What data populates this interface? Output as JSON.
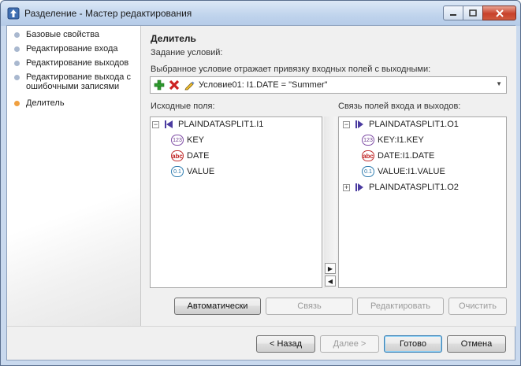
{
  "window": {
    "title": "Разделение - Мастер редактирования"
  },
  "steps": [
    {
      "label": "Базовые свойства",
      "active": false
    },
    {
      "label": "Редактирование входа",
      "active": false
    },
    {
      "label": "Редактирование выходов",
      "active": false
    },
    {
      "label": "Редактирование выхода с ошибочными записями",
      "active": false
    },
    {
      "label": "Делитель",
      "active": true
    }
  ],
  "page": {
    "title": "Делитель",
    "conditions_label": "Задание условий:",
    "selected_condition_label": "Выбранное условие отражает привязку входных полей с выходными:",
    "condition_value": "Условие01: I1.DATE = \"Summer\"",
    "source_fields_label": "Исходные поля:",
    "mapping_label": "Связь полей входа и выходов:"
  },
  "source_tree": {
    "root": "PLAINDATASPLIT1.I1",
    "fields": [
      {
        "type": "123",
        "name": "KEY"
      },
      {
        "type": "abc",
        "name": "DATE"
      },
      {
        "type": "0.1",
        "name": "VALUE"
      }
    ]
  },
  "mapping_tree": {
    "outputs": [
      {
        "name": "PLAINDATASPLIT1.O1",
        "expanded": true,
        "fields": [
          {
            "type": "123",
            "name": "KEY:I1.KEY"
          },
          {
            "type": "abc",
            "name": "DATE:I1.DATE"
          },
          {
            "type": "0.1",
            "name": "VALUE:I1.VALUE"
          }
        ]
      },
      {
        "name": "PLAINDATASPLIT1.O2",
        "expanded": false,
        "fields": []
      }
    ]
  },
  "action_buttons": {
    "auto": "Автоматически",
    "link": "Связь",
    "edit": "Редактировать",
    "clear": "Очистить"
  },
  "nav_buttons": {
    "back": "< Назад",
    "next": "Далее >",
    "finish": "Готово",
    "cancel": "Отмена"
  },
  "colors": {
    "active_step": "#f0a040",
    "inactive_step": "#a9b8cf",
    "add_icon": "#2e9a2e",
    "delete_icon": "#cc2222",
    "port_icon": "#4b3ba0"
  }
}
